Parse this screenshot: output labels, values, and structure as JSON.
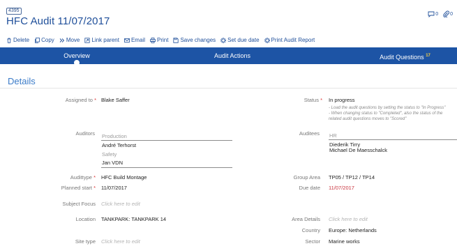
{
  "record": {
    "id": "4395",
    "title": "HFC Audit 11/07/2017"
  },
  "header_icons": {
    "comments_count": "0",
    "attachments_count": "0"
  },
  "toolbar": [
    {
      "label": "Delete",
      "icon": "trash-icon"
    },
    {
      "label": "Copy",
      "icon": "copy-icon"
    },
    {
      "label": "Move",
      "icon": "move-icon"
    },
    {
      "label": "Link parent",
      "icon": "link-icon"
    },
    {
      "label": "Email",
      "icon": "email-icon"
    },
    {
      "label": "Print",
      "icon": "print-icon"
    },
    {
      "label": "Save changes",
      "icon": "save-icon"
    },
    {
      "label": "Set due date",
      "icon": "gear-icon"
    },
    {
      "label": "Print Audit Report",
      "icon": "gear-icon"
    }
  ],
  "tabs": [
    {
      "label": "Overview",
      "active": true
    },
    {
      "label": "Audit Actions"
    },
    {
      "label": "Audit Questions",
      "badge": "17"
    }
  ],
  "section_title": "Details",
  "fields": {
    "assigned_to": {
      "label": "Assigned to",
      "value": "Blake Saffer"
    },
    "status": {
      "label": "Status",
      "value": "In progress",
      "hints": [
        "- Load the audit questions by setting the status to \"In Progress\"",
        "- When changing status to \"Completed\", also the status of the",
        "related audit questions moves to \"Scored\""
      ]
    },
    "auditors": {
      "label": "Auditors",
      "groups": [
        {
          "name": "Production",
          "members": [
            "André Terhorst"
          ]
        },
        {
          "name": "Safety",
          "members": [
            "Jan VDN"
          ]
        }
      ]
    },
    "auditees": {
      "label": "Auditees",
      "groups": [
        {
          "name": "HR",
          "members": [
            "Diederik Tirry",
            "Michael De Maesschalck"
          ]
        }
      ]
    },
    "audit_type": {
      "label": "Audittype",
      "value": "HFC Build Montage"
    },
    "group_area": {
      "label": "Group Area",
      "value": "TP05 / TP12 / TP14"
    },
    "planned_start": {
      "label": "Planned start",
      "value": "11/07/2017"
    },
    "due_date": {
      "label": "Due date",
      "value": "11/07/2017"
    },
    "subject_focus": {
      "label": "Subject Focus",
      "placeholder": "Click here to edit"
    },
    "location": {
      "label": "Location",
      "value": "TANKPARK: TANKPARK 14"
    },
    "area_details": {
      "label": "Area Details",
      "placeholder": "Click here to edit"
    },
    "country": {
      "label": "Country",
      "value": "Europe: Netherlands"
    },
    "site_type": {
      "label": "Site type",
      "placeholder": "Click here to edit"
    },
    "sector": {
      "label": "Sector",
      "value": "Marine works"
    }
  },
  "colors": {
    "primary": "#1d54a5",
    "accent": "#3b7bc8",
    "required": "#d33333",
    "due": "#c8323c",
    "badge": "#ffd23c"
  }
}
